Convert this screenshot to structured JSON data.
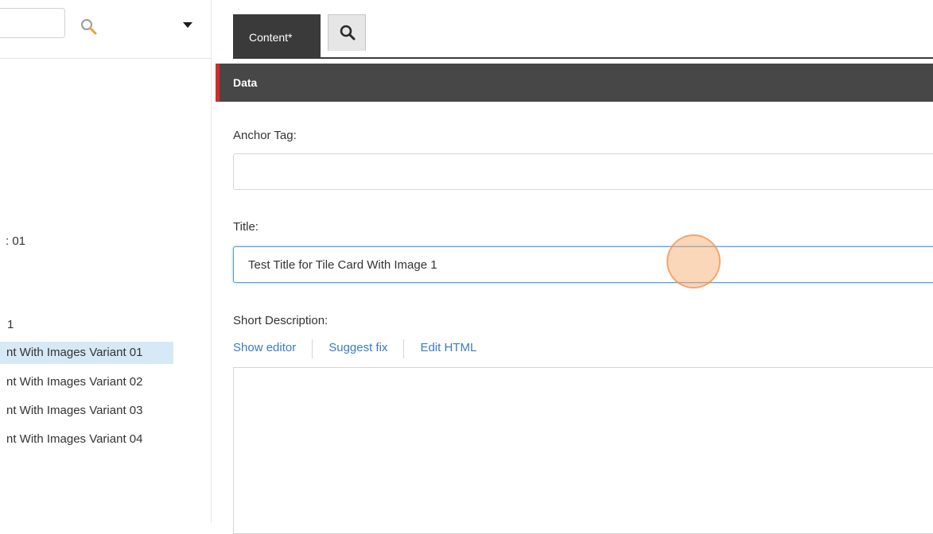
{
  "tree": {
    "search_value": "",
    "items": [
      {
        "label": ": 01",
        "selected": false
      },
      {
        "label": "1",
        "selected": false
      },
      {
        "label": "nt With Images Variant 01",
        "selected": true
      },
      {
        "label": "nt With Images Variant 02",
        "selected": false
      },
      {
        "label": "nt With Images Variant 03",
        "selected": false
      },
      {
        "label": "nt With Images Variant 04",
        "selected": false
      }
    ]
  },
  "editor": {
    "tabs": {
      "content_label": "Content*"
    },
    "section_title": "Data",
    "fields": {
      "anchor_label": "Anchor Tag:",
      "anchor_value": "",
      "title_label": "Title:",
      "title_value": "Test Title for Tile Card With Image 1",
      "short_desc_label": "Short Description:"
    },
    "editor_links": {
      "show_editor": "Show editor",
      "suggest_fix": "Suggest fix",
      "edit_html": "Edit HTML"
    }
  },
  "colors": {
    "accent_red": "#d42a2a",
    "header_dark": "#474747",
    "selection": "#d6e9f6",
    "link": "#3a7cc2",
    "cursor_highlight": "#f6a666"
  }
}
